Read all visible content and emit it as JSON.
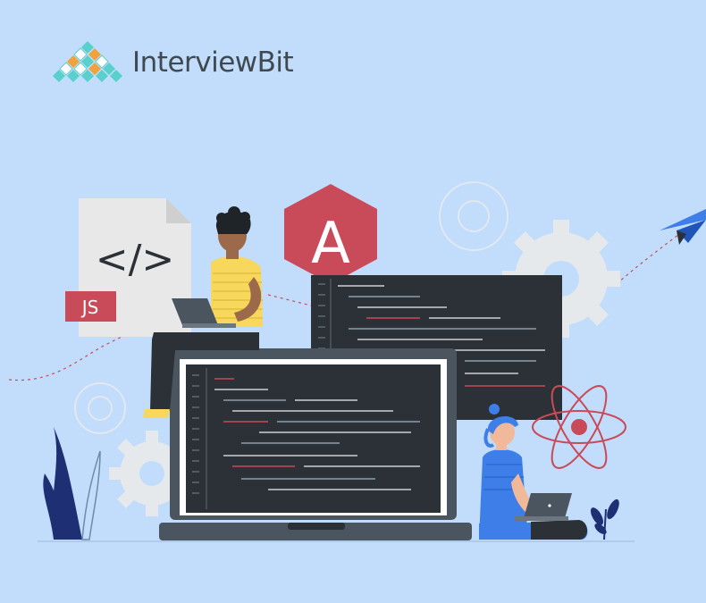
{
  "brand": {
    "name": "InterviewBit",
    "logo_colors": [
      "#5ad0cd",
      "#f0a33a",
      "#ffffff"
    ]
  },
  "illustration": {
    "js_badge_label": "JS",
    "code_tag_glyph": "</>",
    "framework_letter": "A",
    "icons": [
      "code-file-icon",
      "angular-logo-icon",
      "react-atom-icon",
      "paper-plane-icon",
      "gear-icon"
    ],
    "colors": {
      "background": "#c2dcfb",
      "monitor": "#2b3137",
      "accent_red": "#c94a58",
      "shirt_yellow": "#f7d75c",
      "shirt_blue": "#3d7ee8"
    }
  }
}
